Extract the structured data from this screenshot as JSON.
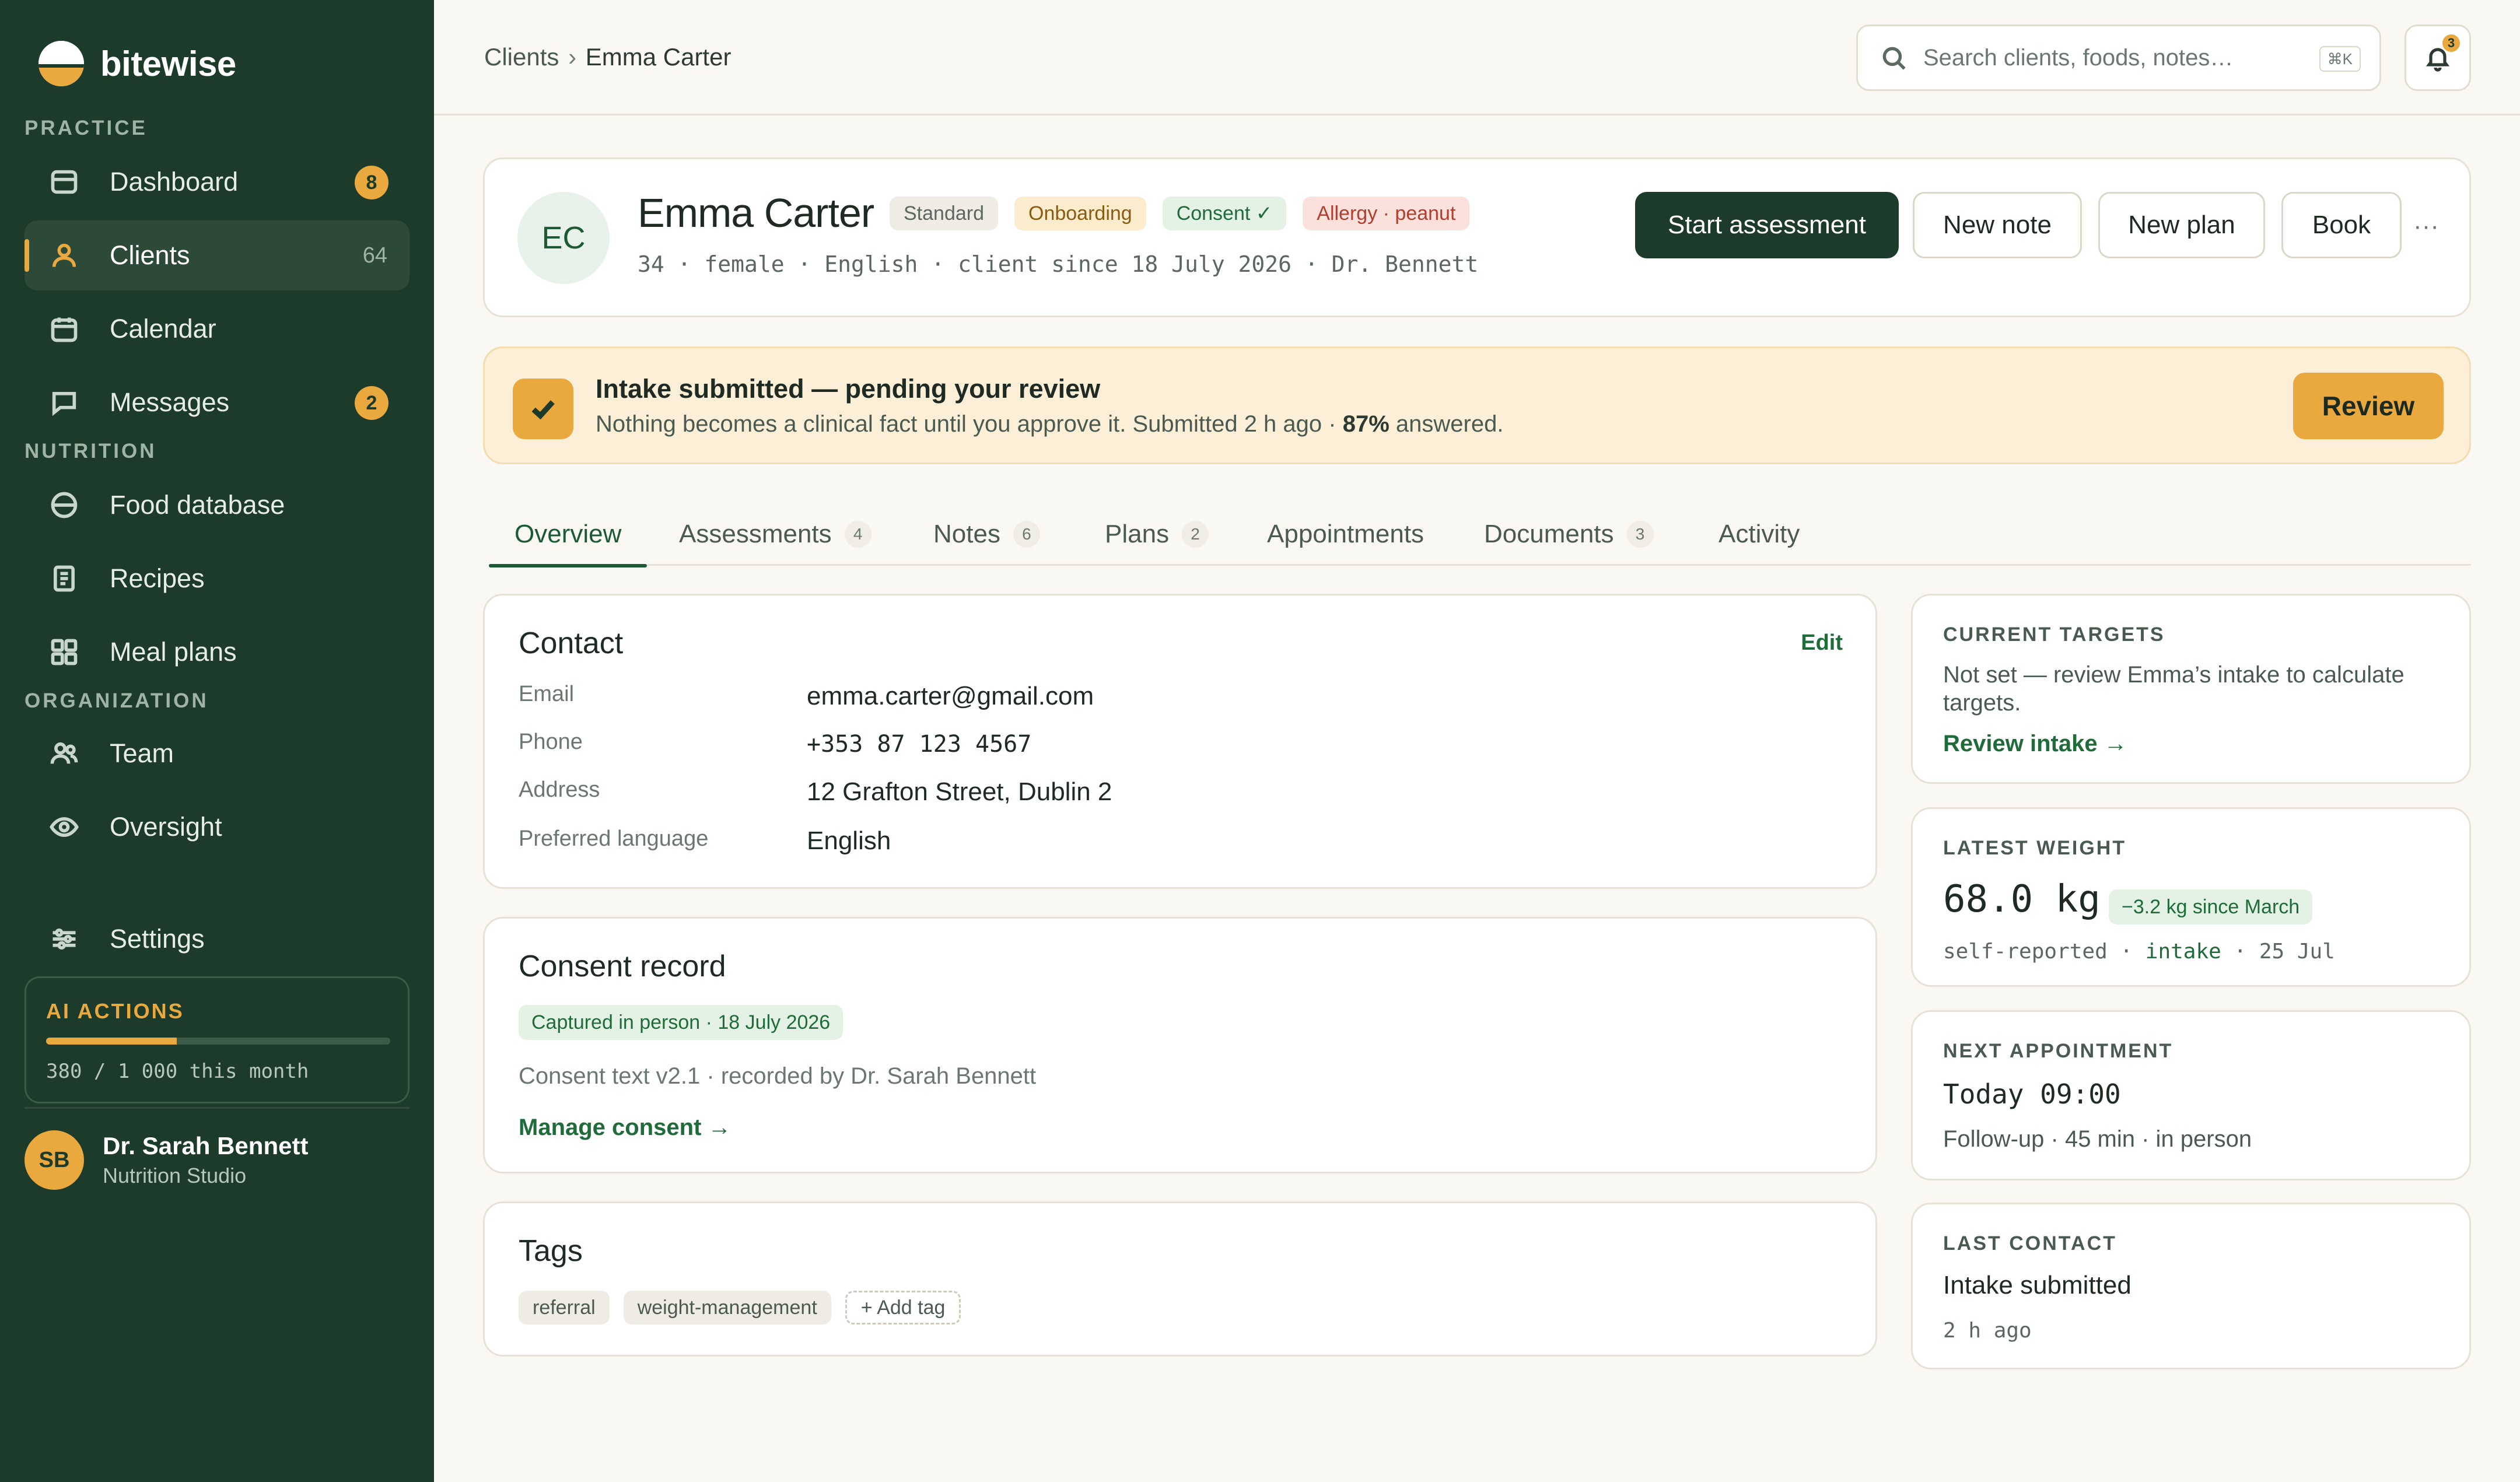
{
  "brand": {
    "name": "bitewise",
    "accent": "#e9a93f",
    "sidebar_bg": "#1c3b2a"
  },
  "sidebar": {
    "section_practice": "PRACTICE",
    "section_nutrition": "NUTRITION",
    "section_organization": "ORGANIZATION",
    "items": [
      {
        "label": "Dashboard",
        "icon": "dashboard-icon",
        "badge": "8"
      },
      {
        "label": "Clients",
        "icon": "user-icon",
        "count": "64",
        "active": true
      },
      {
        "label": "Calendar",
        "icon": "calendar-icon"
      },
      {
        "label": "Messages",
        "icon": "message-icon",
        "badge": "2"
      },
      {
        "label": "Food database",
        "icon": "food-database-icon"
      },
      {
        "label": "Recipes",
        "icon": "recipe-icon"
      },
      {
        "label": "Meal plans",
        "icon": "grid-icon"
      },
      {
        "label": "Team",
        "icon": "team-icon"
      },
      {
        "label": "Oversight",
        "icon": "eye-icon"
      },
      {
        "label": "Settings",
        "icon": "sliders-icon"
      }
    ],
    "ai_actions": {
      "title": "AI ACTIONS",
      "usage_text": "380 / 1 000 this month",
      "used": 380,
      "limit": 1000
    },
    "user": {
      "initials": "SB",
      "name": "Dr. Sarah Bennett",
      "org": "Nutrition Studio"
    }
  },
  "topbar": {
    "breadcrumb_parent": "Clients",
    "breadcrumb_sep": "›",
    "breadcrumb_current": "Emma Carter",
    "search_placeholder": "Search clients, foods, notes…",
    "search_shortcut": "⌘K",
    "notifications_count": "3"
  },
  "client": {
    "initials": "EC",
    "name": "Emma Carter",
    "tags": {
      "plan": "Standard",
      "stage": "Onboarding",
      "consent": "Consent ✓",
      "allergy": "Allergy · peanut"
    },
    "meta": "34 · female · English · client since 18 July 2026 · Dr. Bennett",
    "actions": {
      "start_assessment": "Start assessment",
      "new_note": "New note",
      "new_plan": "New plan",
      "book": "Book",
      "more": "···"
    }
  },
  "banner": {
    "title": "Intake submitted — pending your review",
    "sub_prefix": "Nothing becomes a clinical fact until you approve it. Submitted 2  h ago · ",
    "sub_bold": "87%",
    "sub_suffix": " answered.",
    "review_label": "Review"
  },
  "tabs": [
    {
      "label": "Overview",
      "active": true
    },
    {
      "label": "Assessments",
      "count": "4"
    },
    {
      "label": "Notes",
      "count": "6"
    },
    {
      "label": "Plans",
      "count": "2"
    },
    {
      "label": "Appointments"
    },
    {
      "label": "Documents",
      "count": "3"
    },
    {
      "label": "Activity"
    }
  ],
  "contact": {
    "title": "Contact",
    "edit": "Edit",
    "email_label": "Email",
    "email": "emma.carter@gmail.com",
    "phone_label": "Phone",
    "phone": "+353 87 123 4567",
    "address_label": "Address",
    "address": "12 Grafton Street, Dublin 2",
    "language_label": "Preferred language",
    "language": "English"
  },
  "consent": {
    "title": "Consent record",
    "captured": "Captured in person · 18 July 2026",
    "detail": "Consent text v2.1 · recorded by Dr. Sarah Bennett",
    "manage": "Manage consent →"
  },
  "tags_card": {
    "title": "Tags",
    "items": [
      "referral",
      "weight-management"
    ],
    "add": "+ Add tag"
  },
  "targets": {
    "label": "CURRENT TARGETS",
    "text": "Not set — review Emma’s intake to calculate targets.",
    "link": "Review intake →"
  },
  "weight": {
    "label": "LATEST WEIGHT",
    "value": "68.0 kg",
    "delta": "−3.2 kg since March",
    "source_prefix": "self-reported · ",
    "source_link": "intake",
    "source_suffix": " · 25 Jul"
  },
  "appointment": {
    "label": "NEXT APPOINTMENT",
    "time": "Today 09:00",
    "detail": "Follow-up · 45 min · in person"
  },
  "last_contact": {
    "label": "LAST CONTACT",
    "title": "Intake submitted",
    "when": "2 h ago"
  }
}
